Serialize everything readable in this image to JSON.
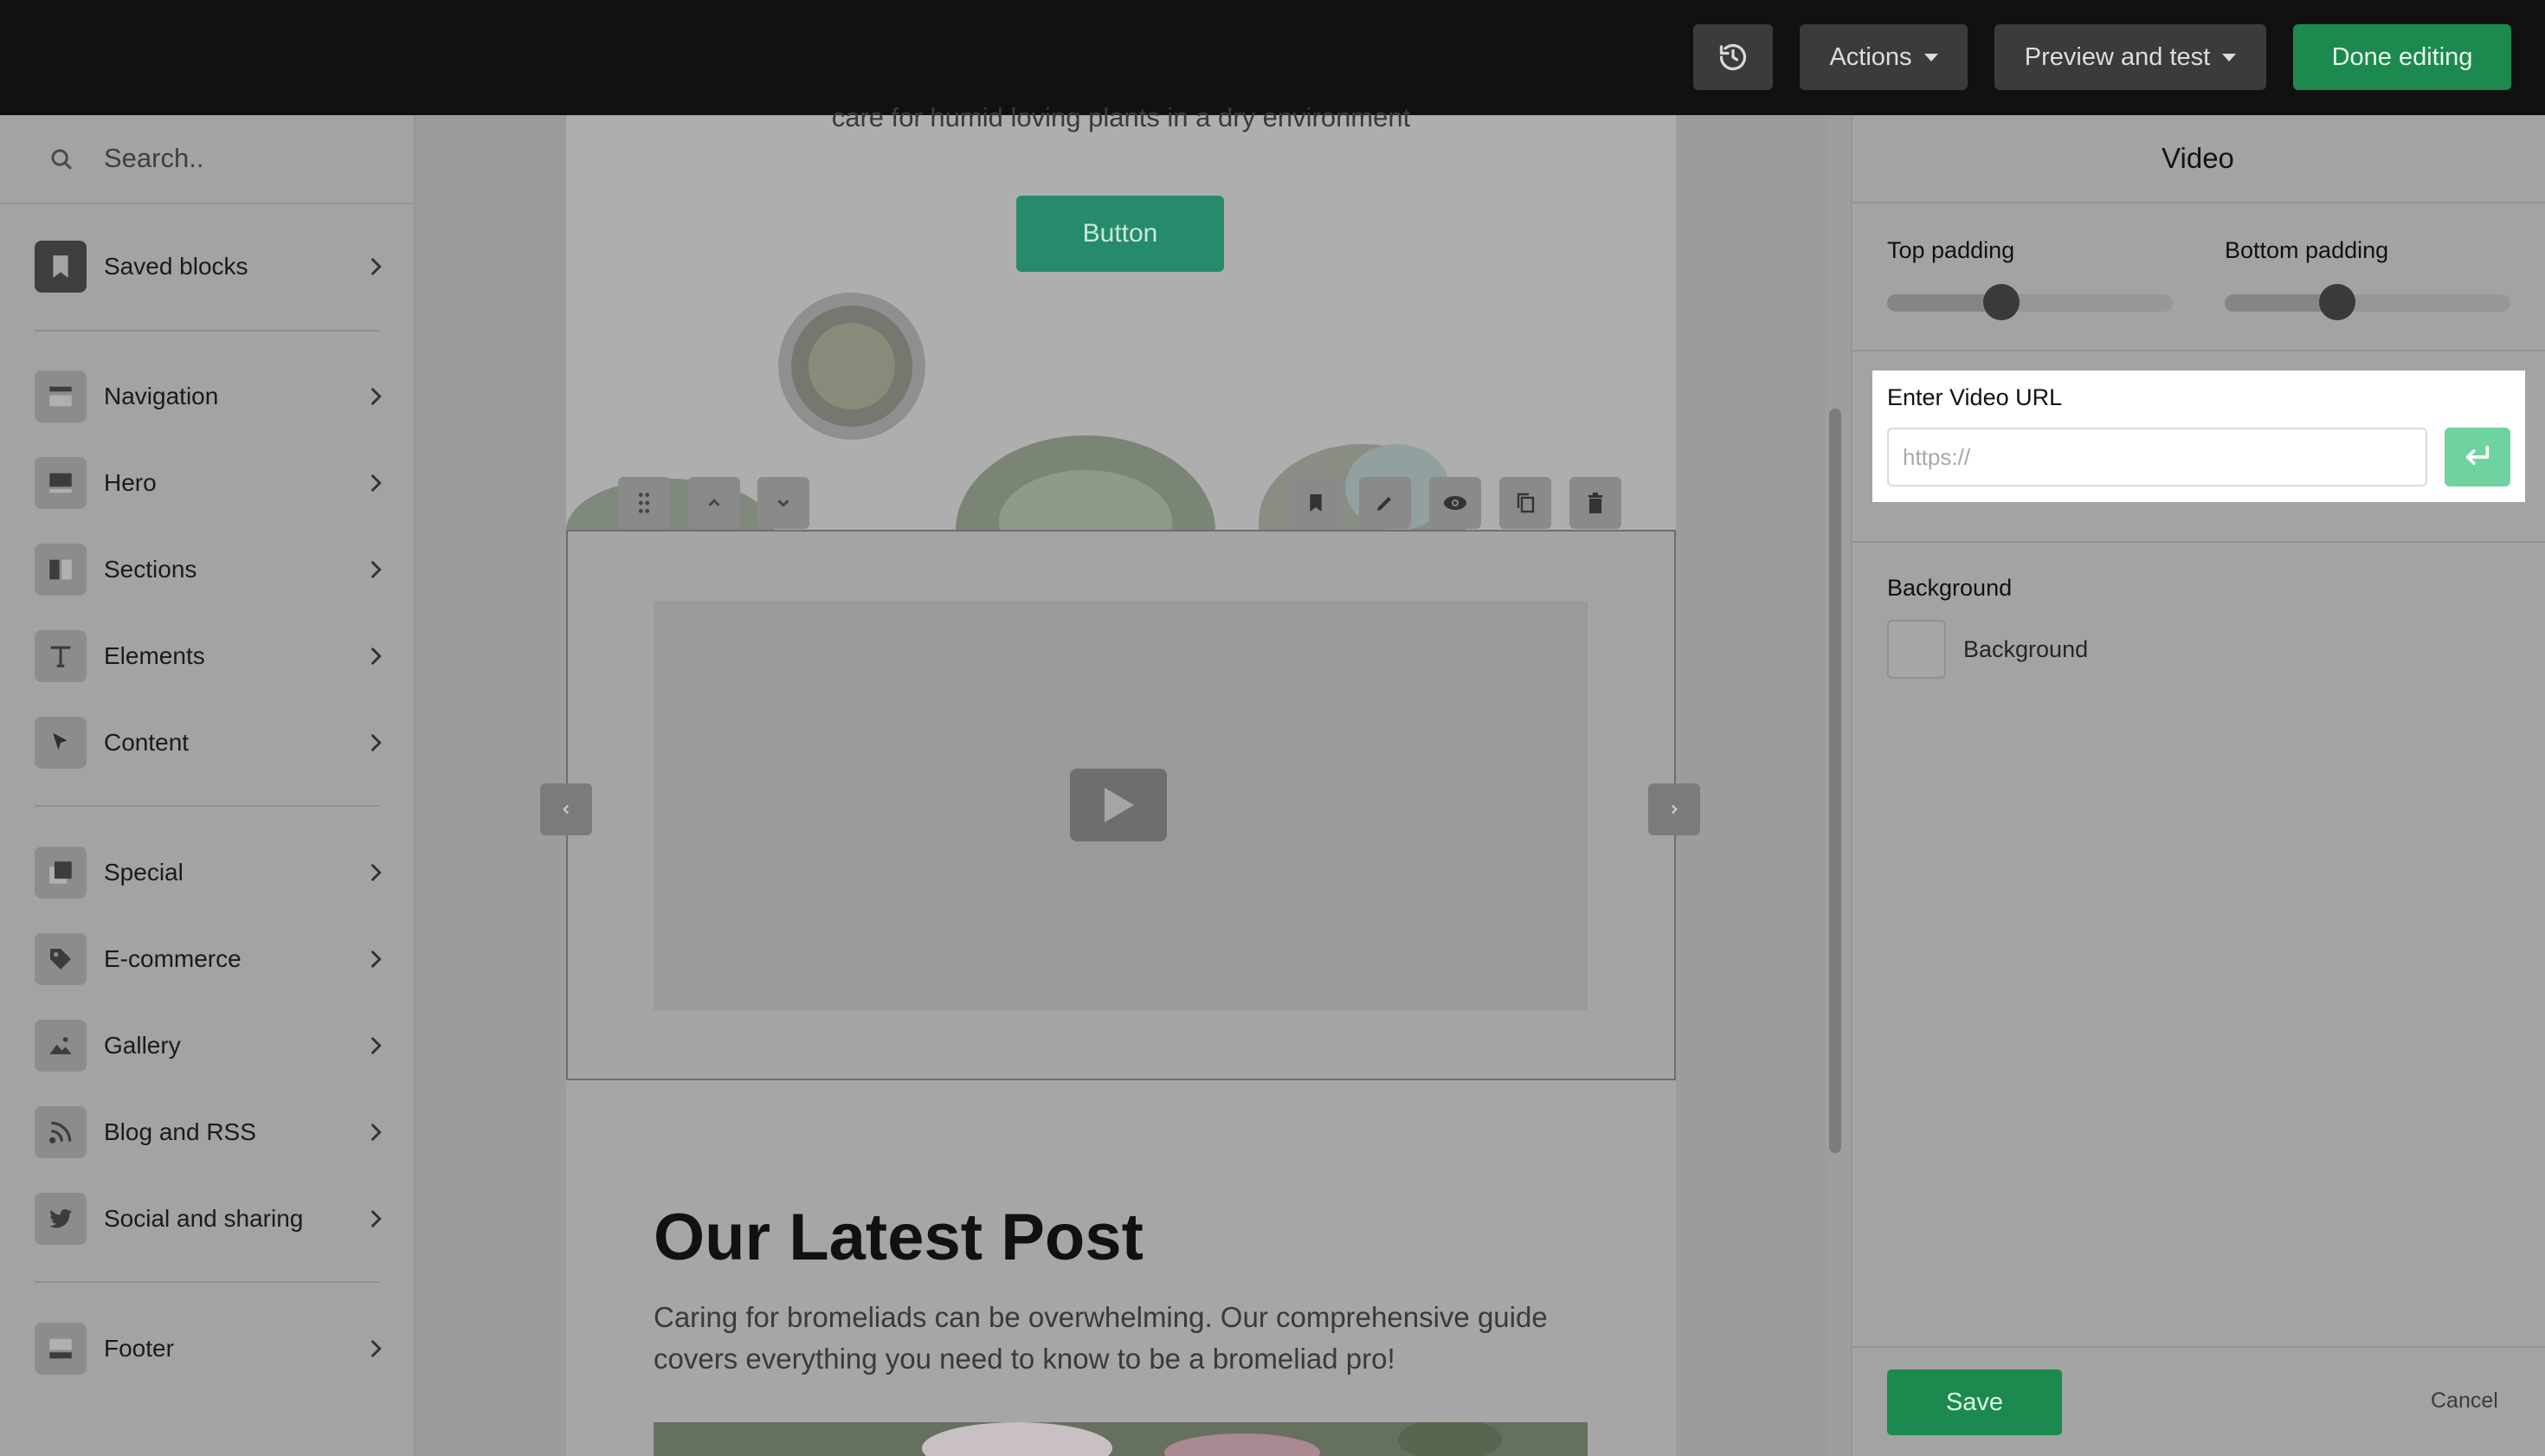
{
  "topbar": {
    "actions_label": "Actions",
    "preview_label": "Preview and test",
    "done_label": "Done editing"
  },
  "sidebar": {
    "search_placeholder": "Search..",
    "items": [
      {
        "label": "Saved blocks",
        "icon": "bookmark-icon"
      },
      {
        "label": "Navigation",
        "icon": "navigation-icon"
      },
      {
        "label": "Hero",
        "icon": "hero-icon"
      },
      {
        "label": "Sections",
        "icon": "sections-icon"
      },
      {
        "label": "Elements",
        "icon": "text-icon"
      },
      {
        "label": "Content",
        "icon": "cursor-icon"
      },
      {
        "label": "Special",
        "icon": "special-icon"
      },
      {
        "label": "E-commerce",
        "icon": "tag-icon"
      },
      {
        "label": "Gallery",
        "icon": "image-icon"
      },
      {
        "label": "Blog and RSS",
        "icon": "rss-icon"
      },
      {
        "label": "Social and sharing",
        "icon": "twitter-icon"
      },
      {
        "label": "Footer",
        "icon": "footer-icon"
      }
    ]
  },
  "canvas": {
    "hero_subtitle": "care for humid loving plants in a dry environment",
    "hero_button": "Button",
    "post_title": "Our Latest Post",
    "post_text": "Caring for bromeliads can be overwhelming. Our comprehensive guide covers everything you need to know to be a bromeliad pro!"
  },
  "panel": {
    "title": "Video",
    "top_padding_label": "Top padding",
    "bottom_padding_label": "Bottom padding",
    "url_label": "Enter Video URL",
    "url_placeholder": "https://",
    "url_value": "",
    "background_label": "Background",
    "background_swatch_label": "Background",
    "save_label": "Save",
    "cancel_label": "Cancel"
  },
  "colors": {
    "accent_green": "#1c8a4f",
    "enter_button": "#6fd3a0",
    "topbar": "#111111"
  }
}
